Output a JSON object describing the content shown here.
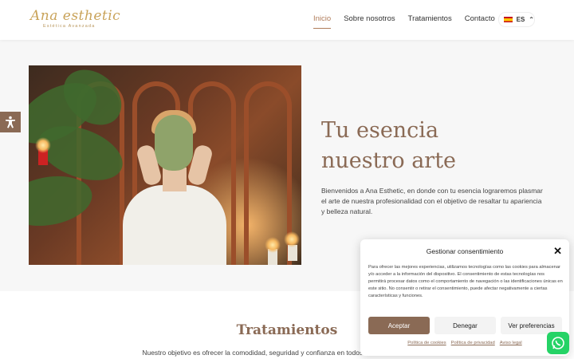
{
  "brand": {
    "name": "Ana esthetic",
    "tagline": "Estética Avanzada"
  },
  "nav": {
    "items": [
      {
        "label": "Inicio",
        "active": true
      },
      {
        "label": "Sobre nosotros"
      },
      {
        "label": "Tratamientos"
      },
      {
        "label": "Contacto"
      }
    ],
    "language": "ES"
  },
  "hero": {
    "title_line1": "Tu esencia",
    "title_line2": "nuestro arte",
    "text": "Bienvenidos a Ana Esthetic, en donde con tu esencia lograremos plasmar el arte de nuestra profesionalidad con el objetivo de resaltar tu apariencia y belleza natural."
  },
  "treatments": {
    "title": "Tratamientos",
    "text": "Nuestro objetivo es ofrecer la comodidad, seguridad y confianza en todos nuestros tratamientos,"
  },
  "consent": {
    "title": "Gestionar consentimiento",
    "body": "Para ofrecer las mejores experiencias, utilizamos tecnologías como las cookies para almacenar y/o acceder a la información del dispositivo. El consentimiento de estas tecnologías nos permitirá procesar datos como el comportamiento de navegación o las identificaciones únicas en este sitio. No consentir o retirar el consentimiento, puede afectar negativamente a ciertas características y funciones.",
    "accept": "Aceptar",
    "deny": "Denegar",
    "preferences": "Ver preferencias",
    "links": [
      "Política de cookies",
      "Política de privacidad",
      "Aviso legal"
    ]
  },
  "colors": {
    "accent": "#8a6a55",
    "gold": "#c9a35a",
    "whatsapp": "#25d366"
  },
  "icons": [
    "accessibility-icon",
    "close-icon",
    "whatsapp-icon",
    "spain-flag-icon",
    "chevron-up-icon"
  ]
}
